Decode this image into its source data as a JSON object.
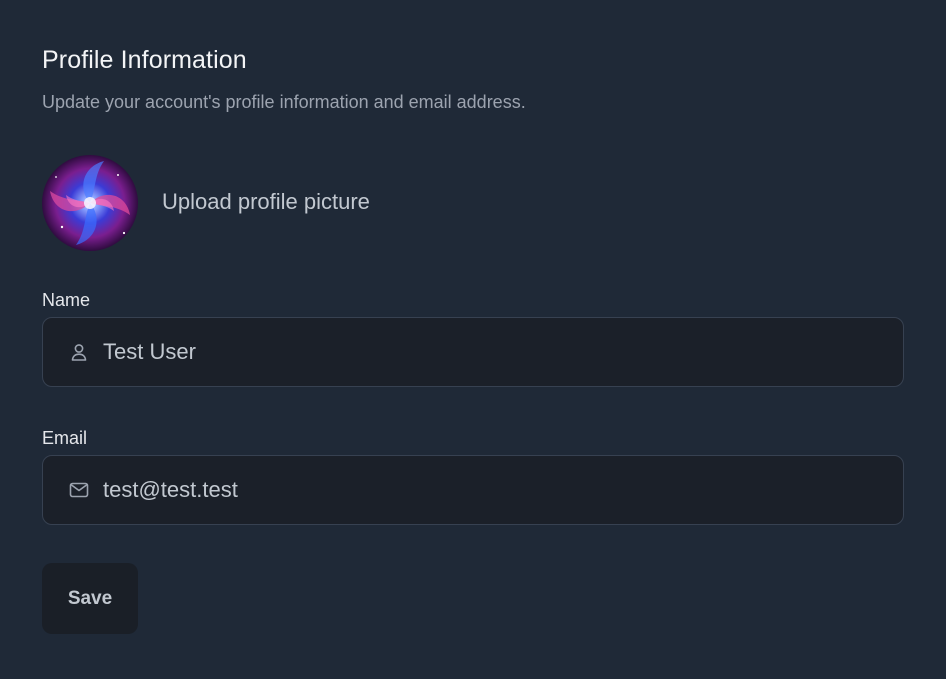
{
  "header": {
    "title": "Profile Information",
    "subtitle": "Update your account's profile information and email address."
  },
  "avatar": {
    "upload_label": "Upload profile picture"
  },
  "form": {
    "name": {
      "label": "Name",
      "value": "Test User",
      "icon": "user-icon"
    },
    "email": {
      "label": "Email",
      "value": "test@test.test",
      "icon": "mail-icon"
    }
  },
  "actions": {
    "save_label": "Save"
  },
  "colors": {
    "background": "#1f2937",
    "input_background": "#1b2029",
    "input_border": "#374151",
    "title": "#f3f4f6",
    "muted_text": "#9ca3af"
  }
}
